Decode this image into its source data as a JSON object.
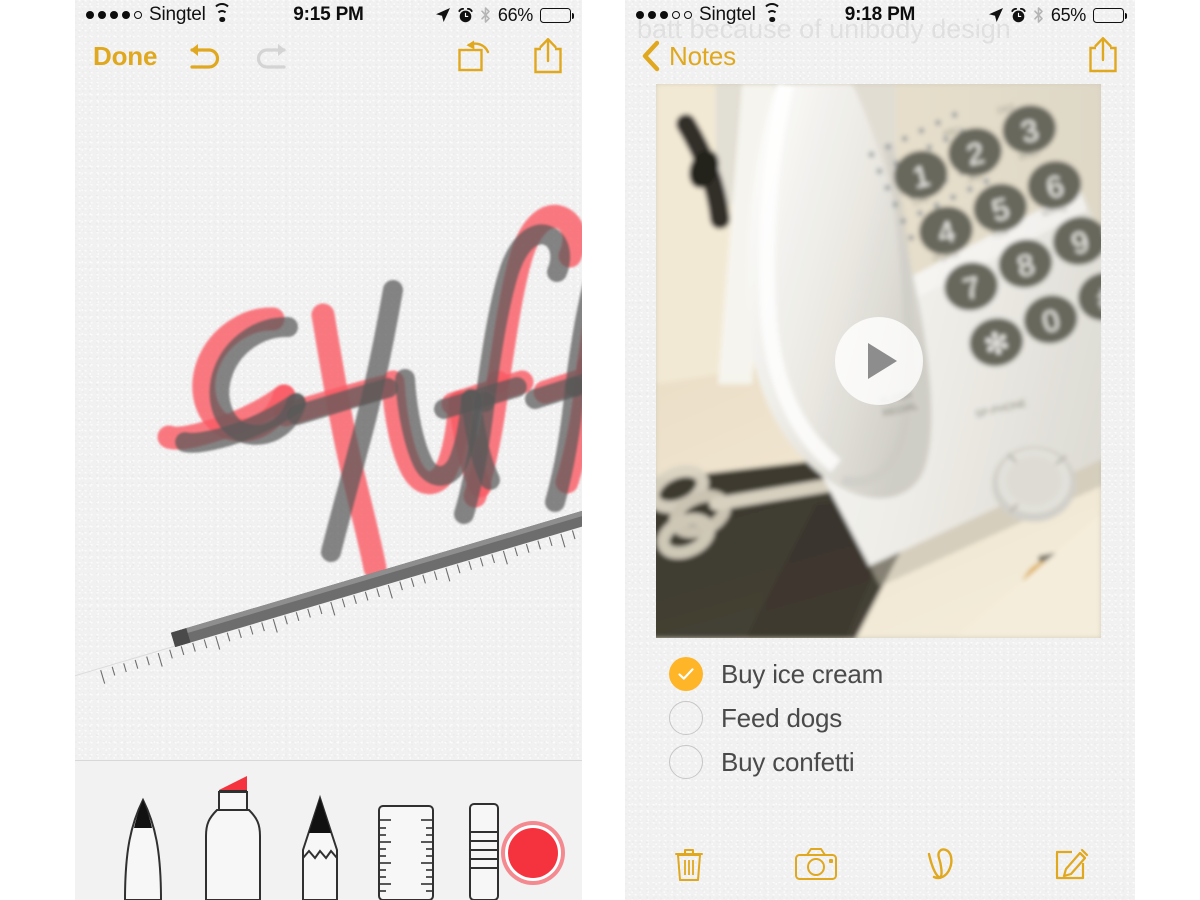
{
  "left_panel": {
    "status_bar": {
      "signal_dots_filled": 4,
      "signal_dots_total": 5,
      "carrier": "Singtel",
      "wifi_icon": "wifi-icon",
      "time": "9:15 PM",
      "location_icon": "location-arrow-icon",
      "alarm_icon": "alarm-clock-icon",
      "bluetooth_icon": "bluetooth-icon",
      "battery_percent": "66%",
      "battery_level": 66,
      "battery_color": "#ffcc00"
    },
    "toolbar": {
      "done_label": "Done",
      "done_color": "#e0a81e",
      "undo_icon": "undo-arrow-icon",
      "undo_enabled": true,
      "redo_icon": "redo-arrow-icon",
      "redo_enabled": false,
      "redo_color": "#d0d0d0",
      "rotate_icon": "rotate-square-icon",
      "share_icon": "share-box-arrow-up-icon"
    },
    "canvas": {
      "handwritten_text": "Stuff",
      "stroke_color_grey": "#595959",
      "stroke_color_red": "#fb5a64",
      "ruler_overlay": "ruler-guide",
      "ruler_color": "#6d6d6d",
      "background": "#f1f1f1"
    },
    "tool_tray": {
      "tools": [
        {
          "name": "pen-tool",
          "label": "Pen",
          "selected": false
        },
        {
          "name": "highlighter-tool",
          "label": "Highlighter",
          "selected": true,
          "tip_color": "#f5333f"
        },
        {
          "name": "pencil-tool",
          "label": "Pencil",
          "selected": false
        },
        {
          "name": "ruler-tool",
          "label": "Ruler",
          "selected": false
        },
        {
          "name": "eraser-tool",
          "label": "Eraser",
          "selected": false
        }
      ],
      "color_swatch": {
        "name": "color-swatch",
        "label": "Red",
        "color": "#f5333f",
        "selected": true
      }
    }
  },
  "right_panel": {
    "ghost_watermark": "batt because of unibody design",
    "status_bar": {
      "signal_dots_filled": 3,
      "signal_dots_total": 5,
      "carrier": "Singtel",
      "wifi_icon": "wifi-icon",
      "time": "9:18 PM",
      "location_icon": "location-arrow-icon",
      "alarm_icon": "alarm-clock-icon",
      "bluetooth_icon": "bluetooth-icon",
      "battery_percent": "65%",
      "battery_level": 65,
      "battery_color": "#ffcc00"
    },
    "navbar": {
      "back_icon": "chevron-left-icon",
      "back_label": "Notes",
      "tint_color": "#e0a81e",
      "share_icon": "share-box-arrow-up-icon"
    },
    "attachment": {
      "type": "video",
      "subject": "white office telephone on a desk",
      "play_icon": "play-triangle-icon"
    },
    "checklist": [
      {
        "label": "Buy ice cream",
        "checked": true
      },
      {
        "label": "Feed dogs",
        "checked": false
      },
      {
        "label": "Buy confetti",
        "checked": false
      }
    ],
    "checked_color": "#ffb528",
    "bottom_bar": [
      {
        "name": "delete-button",
        "icon": "trash-icon",
        "label": "Delete"
      },
      {
        "name": "camera-button",
        "icon": "camera-icon",
        "label": "Camera"
      },
      {
        "name": "sketch-button",
        "icon": "squiggle-icon",
        "label": "Sketch"
      },
      {
        "name": "compose-button",
        "icon": "compose-pencil-icon",
        "label": "Compose"
      }
    ],
    "bottom_bar_tint": "#e0a81e"
  }
}
